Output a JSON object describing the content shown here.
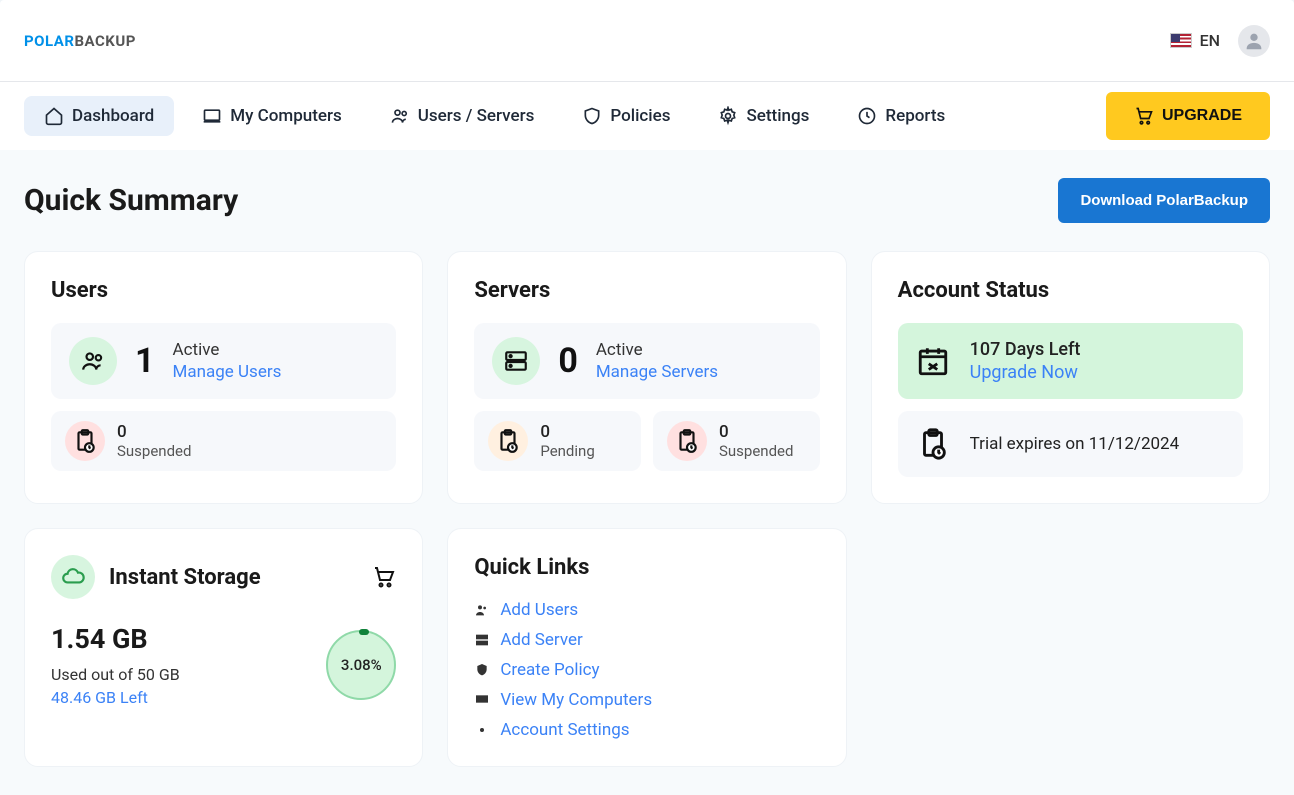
{
  "brand": {
    "part1": "POLAR",
    "part2": "BACKUP"
  },
  "lang": "EN",
  "nav": {
    "dashboard": "Dashboard",
    "computers": "My Computers",
    "users": "Users / Servers",
    "policies": "Policies",
    "settings": "Settings",
    "reports": "Reports",
    "upgrade": "UPGRADE"
  },
  "page": {
    "title": "Quick Summary",
    "download": "Download PolarBackup"
  },
  "users": {
    "title": "Users",
    "count": "1",
    "active_label": "Active",
    "manage": "Manage Users",
    "suspended_count": "0",
    "suspended_label": "Suspended"
  },
  "servers": {
    "title": "Servers",
    "count": "0",
    "active_label": "Active",
    "manage": "Manage Servers",
    "pending_count": "0",
    "pending_label": "Pending",
    "suspended_count": "0",
    "suspended_label": "Suspended"
  },
  "account": {
    "title": "Account Status",
    "days_left": "107 Days Left",
    "upgrade_now": "Upgrade Now",
    "trial_expires": "Trial expires on 11/12/2024"
  },
  "storage": {
    "title": "Instant Storage",
    "used": "1.54 GB",
    "used_out_of": "Used out of  50 GB",
    "left": "48.46 GB Left",
    "percent": "3.08%"
  },
  "quicklinks": {
    "title": "Quick Links",
    "add_users": "Add Users",
    "add_server": "Add Server",
    "create_policy": "Create Policy",
    "view_computers": "View My Computers",
    "account_settings": "Account Settings"
  }
}
